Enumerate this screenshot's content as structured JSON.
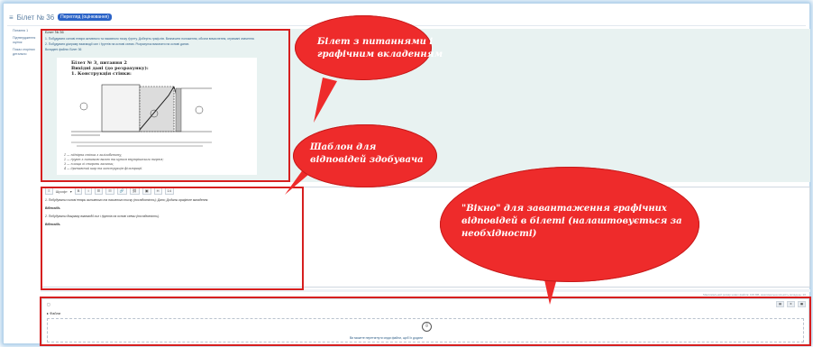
{
  "header": {
    "title": "Білет № 36",
    "badge": "Перегляд (оцінювання)"
  },
  "sidebar": {
    "items": [
      "Питання 1",
      "Підтвердження оцінок",
      "Показ сторінки детально"
    ]
  },
  "question": {
    "header": "Білет № 36",
    "lines": [
      "1. Побудувати силові епюри активного та пасивного тиску ґрунту. Доберіть граф-пів. Визначити положення, обсяги вичислення, отримані значення.",
      "2. Побудувати діаграму взаємодії сил і ґрунтів на основі схеми. Розрахунок виконати на основі даних.",
      "Вкладені файли: Білет 36"
    ],
    "doc_heading": [
      "Білет № 3, питання 2",
      "Вихідні дані (до розрахунку):",
      "1. Конструкція стінки:"
    ],
    "doc_caption": [
      "1 — підпірна стінка з залізобетону;",
      "2 — ґрунт з питомою вагою та кутом внутрішнього тертя;",
      "3 — площа зі сторони засипки;",
      "4 — дренажний шар та конструкція фільтрації."
    ]
  },
  "editor": {
    "toolbar": [
      "Ξ",
      "Шрифт",
      "▾",
      "B",
      "I",
      "☰",
      "☷",
      "🔗",
      "⛓",
      "▣",
      "H",
      "14"
    ],
    "lines": [
      "1. Побудувати силові епюри активного та пасивного тиску (послідовність): Дано; Додати графічне вкладення.",
      "Відповідь",
      "2. Побудувати діаграму взаємодії сил і ґрунтів на основі схеми (послідовність).",
      "Відповідь"
    ]
  },
  "upload": {
    "hint": "Максимальний розмір нових файлів: 100 МБ, максимальна кількість вкладень: 20",
    "toolbar_label": "Файли",
    "folder_label": "▸ Файли",
    "buttons": [
      "▤",
      "≡",
      "▦"
    ],
    "drop_text": "Ви можете перетягнути сюди файли, щоб їх додати"
  },
  "annotations": {
    "bubble1": [
      "Білет з питаннями і",
      "графічним вкладенням"
    ],
    "bubble2": [
      "Шаблон для",
      "відповідей здобувача"
    ],
    "bubble3": [
      "\"Вікно\" для завантаження графічних",
      "відповідей в білеті (налаштовується за",
      "необхідності)"
    ]
  }
}
